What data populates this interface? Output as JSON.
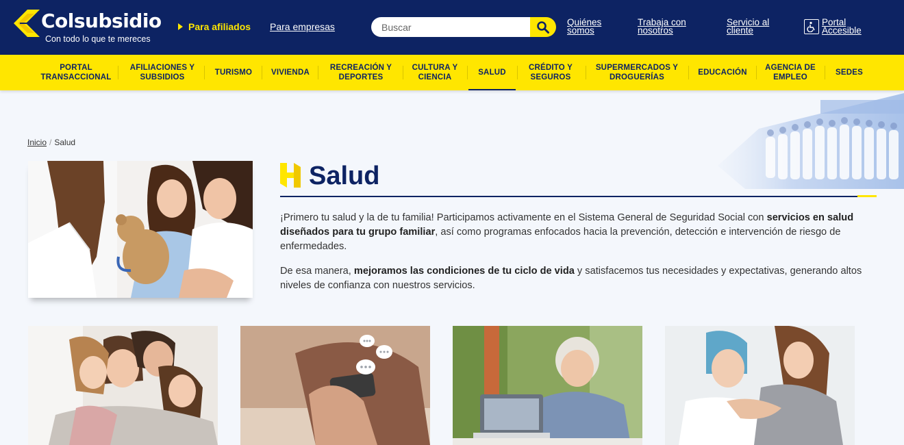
{
  "header": {
    "logo_text": "Colsubsidio",
    "logo_tagline": "Con todo lo que te mereces",
    "nav_affiliates": "Para afiliados",
    "nav_companies": "Para empresas",
    "search_placeholder": "Buscar",
    "links": {
      "about_l1": "Quiénes",
      "about_l2": "somos",
      "jobs_l1": "Trabaja con",
      "jobs_l2": "nosotros",
      "service_l1": "Servicio al",
      "service_l2": "cliente",
      "access_l1": "Portal",
      "access_l2": "Accesible"
    }
  },
  "mainnav": {
    "items": [
      {
        "l1": "PORTAL",
        "l2": "TRANSACCIONAL"
      },
      {
        "l1": "AFILIACIONES Y",
        "l2": "SUBSIDIOS"
      },
      {
        "l1": "TURISMO",
        "l2": ""
      },
      {
        "l1": "VIVIENDA",
        "l2": ""
      },
      {
        "l1": "RECREACIÓN Y",
        "l2": "DEPORTES"
      },
      {
        "l1": "CULTURA Y",
        "l2": "CIENCIA"
      },
      {
        "l1": "SALUD",
        "l2": ""
      },
      {
        "l1": "CRÉDITO Y",
        "l2": "SEGUROS"
      },
      {
        "l1": "SUPERMERCADOS Y",
        "l2": "DROGUERÍAS"
      },
      {
        "l1": "EDUCACIÓN",
        "l2": ""
      },
      {
        "l1": "AGENCIA DE",
        "l2": "EMPLEO"
      },
      {
        "l1": "SEDES",
        "l2": ""
      }
    ],
    "active": "SALUD"
  },
  "breadcrumb": {
    "home": "Inicio",
    "separator": "/",
    "current": "Salud"
  },
  "content": {
    "title": "Salud",
    "p1_a": "¡Primero tu salud y la de tu familia! Participamos activamente en el Sistema General de Seguridad Social con ",
    "p1_b": "servicios en salud diseñados para  tu grupo familiar",
    "p1_c": ", así como programas enfocados hacia la prevención, detección e intervención de riesgo de enfermedades.",
    "p2_a": "De esa manera, ",
    "p2_b": "mejoramos las condiciones de tu ciclo de vida",
    "p2_c": " y satisfacemos tus necesidades y expectativas, generando altos niveles de confianza con nuestros servicios."
  },
  "colors": {
    "navy": "#0d2363",
    "yellow": "#ffe600",
    "background": "#f4f7fc"
  },
  "icons": {
    "search": "search-icon",
    "accessibility": "wheelchair-icon",
    "brand_mark": "colsubsidio-mark-icon",
    "section_mark": "h-mark-icon"
  }
}
